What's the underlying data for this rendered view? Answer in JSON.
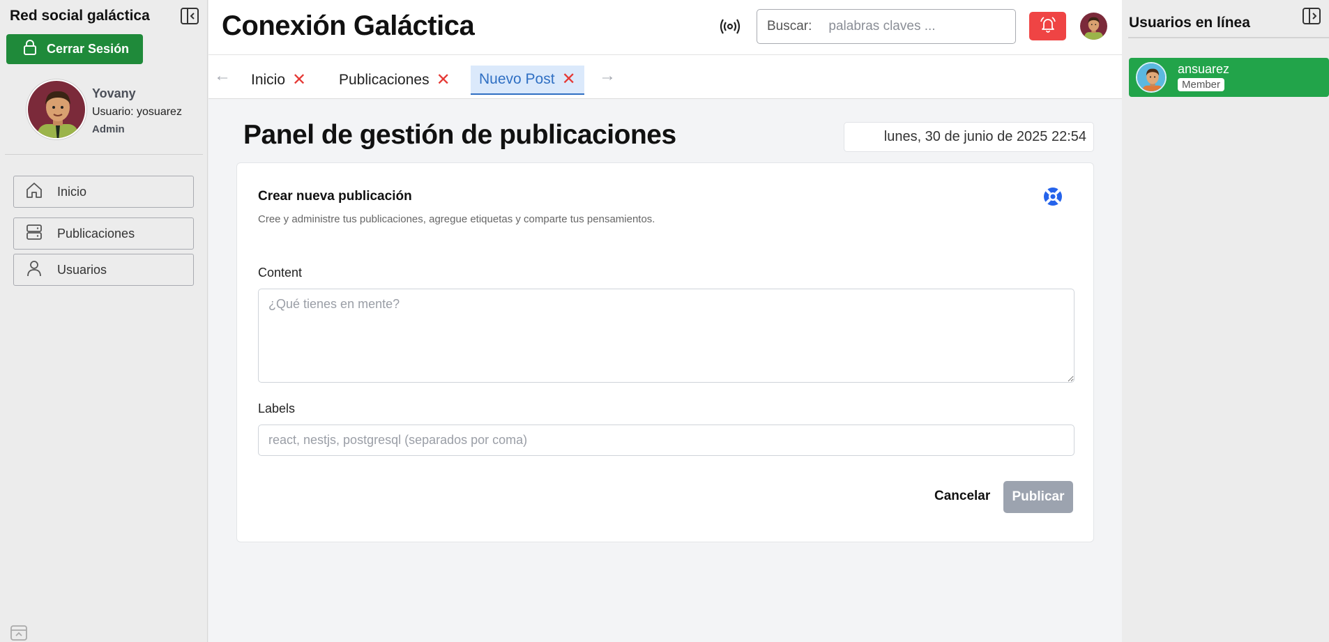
{
  "left_sidebar": {
    "brand": "Red social galáctica",
    "logout_label": "Cerrar Sesión",
    "profile": {
      "name": "Yovany",
      "username": "Usuario: yosuarez",
      "role": "Admin"
    },
    "nav": [
      {
        "label": "Inicio",
        "icon": "home-icon"
      },
      {
        "label": "Publicaciones",
        "icon": "server-icon"
      },
      {
        "label": "Usuarios",
        "icon": "user-icon"
      }
    ]
  },
  "header": {
    "title": "Conexión Galáctica",
    "search_label": "Buscar:",
    "search_placeholder": "palabras claves ...",
    "notification_color": "#ef4444"
  },
  "tabs": {
    "items": [
      {
        "label": "Inicio",
        "active": false
      },
      {
        "label": "Publicaciones",
        "active": false
      },
      {
        "label": "Nuevo Post",
        "active": true
      }
    ],
    "prev_arrow": "←",
    "next_arrow": "→",
    "close_glyph": "✕"
  },
  "main": {
    "page_title": "Panel de gestión de publicaciones",
    "datetime": "lunes, 30 de junio de 2025 22:54",
    "card": {
      "title": "Crear nueva publicación",
      "subtitle": "Cree y administre tus publicaciones, agregue etiquetas y comparte tus pensamientos.",
      "content_label": "Content",
      "content_placeholder": "¿Qué tienes en mente?",
      "labels_label": "Labels",
      "labels_placeholder": "react, nestjs, postgresql (separados por coma)",
      "cancel_label": "Cancelar",
      "publish_label": "Publicar"
    }
  },
  "right_sidebar": {
    "title": "Usuarios en línea",
    "users": [
      {
        "name": "ansuarez",
        "badge": "Member"
      }
    ],
    "online_color": "#22a44a"
  },
  "colors": {
    "primary_green": "#1f8a3a",
    "accent_blue": "#2f6fc3",
    "alert_red": "#ef4444"
  }
}
